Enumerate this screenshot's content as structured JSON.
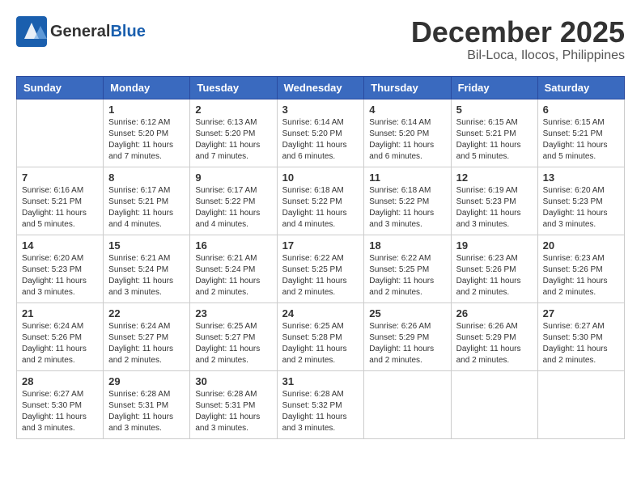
{
  "header": {
    "logo_general": "General",
    "logo_blue": "Blue",
    "month": "December 2025",
    "location": "Bil-Loca, Ilocos, Philippines"
  },
  "days_of_week": [
    "Sunday",
    "Monday",
    "Tuesday",
    "Wednesday",
    "Thursday",
    "Friday",
    "Saturday"
  ],
  "weeks": [
    [
      {
        "day": "",
        "info": ""
      },
      {
        "day": "1",
        "info": "Sunrise: 6:12 AM\nSunset: 5:20 PM\nDaylight: 11 hours\nand 7 minutes."
      },
      {
        "day": "2",
        "info": "Sunrise: 6:13 AM\nSunset: 5:20 PM\nDaylight: 11 hours\nand 7 minutes."
      },
      {
        "day": "3",
        "info": "Sunrise: 6:14 AM\nSunset: 5:20 PM\nDaylight: 11 hours\nand 6 minutes."
      },
      {
        "day": "4",
        "info": "Sunrise: 6:14 AM\nSunset: 5:20 PM\nDaylight: 11 hours\nand 6 minutes."
      },
      {
        "day": "5",
        "info": "Sunrise: 6:15 AM\nSunset: 5:21 PM\nDaylight: 11 hours\nand 5 minutes."
      },
      {
        "day": "6",
        "info": "Sunrise: 6:15 AM\nSunset: 5:21 PM\nDaylight: 11 hours\nand 5 minutes."
      }
    ],
    [
      {
        "day": "7",
        "info": "Sunrise: 6:16 AM\nSunset: 5:21 PM\nDaylight: 11 hours\nand 5 minutes."
      },
      {
        "day": "8",
        "info": "Sunrise: 6:17 AM\nSunset: 5:21 PM\nDaylight: 11 hours\nand 4 minutes."
      },
      {
        "day": "9",
        "info": "Sunrise: 6:17 AM\nSunset: 5:22 PM\nDaylight: 11 hours\nand 4 minutes."
      },
      {
        "day": "10",
        "info": "Sunrise: 6:18 AM\nSunset: 5:22 PM\nDaylight: 11 hours\nand 4 minutes."
      },
      {
        "day": "11",
        "info": "Sunrise: 6:18 AM\nSunset: 5:22 PM\nDaylight: 11 hours\nand 3 minutes."
      },
      {
        "day": "12",
        "info": "Sunrise: 6:19 AM\nSunset: 5:23 PM\nDaylight: 11 hours\nand 3 minutes."
      },
      {
        "day": "13",
        "info": "Sunrise: 6:20 AM\nSunset: 5:23 PM\nDaylight: 11 hours\nand 3 minutes."
      }
    ],
    [
      {
        "day": "14",
        "info": "Sunrise: 6:20 AM\nSunset: 5:23 PM\nDaylight: 11 hours\nand 3 minutes."
      },
      {
        "day": "15",
        "info": "Sunrise: 6:21 AM\nSunset: 5:24 PM\nDaylight: 11 hours\nand 3 minutes."
      },
      {
        "day": "16",
        "info": "Sunrise: 6:21 AM\nSunset: 5:24 PM\nDaylight: 11 hours\nand 2 minutes."
      },
      {
        "day": "17",
        "info": "Sunrise: 6:22 AM\nSunset: 5:25 PM\nDaylight: 11 hours\nand 2 minutes."
      },
      {
        "day": "18",
        "info": "Sunrise: 6:22 AM\nSunset: 5:25 PM\nDaylight: 11 hours\nand 2 minutes."
      },
      {
        "day": "19",
        "info": "Sunrise: 6:23 AM\nSunset: 5:26 PM\nDaylight: 11 hours\nand 2 minutes."
      },
      {
        "day": "20",
        "info": "Sunrise: 6:23 AM\nSunset: 5:26 PM\nDaylight: 11 hours\nand 2 minutes."
      }
    ],
    [
      {
        "day": "21",
        "info": "Sunrise: 6:24 AM\nSunset: 5:26 PM\nDaylight: 11 hours\nand 2 minutes."
      },
      {
        "day": "22",
        "info": "Sunrise: 6:24 AM\nSunset: 5:27 PM\nDaylight: 11 hours\nand 2 minutes."
      },
      {
        "day": "23",
        "info": "Sunrise: 6:25 AM\nSunset: 5:27 PM\nDaylight: 11 hours\nand 2 minutes."
      },
      {
        "day": "24",
        "info": "Sunrise: 6:25 AM\nSunset: 5:28 PM\nDaylight: 11 hours\nand 2 minutes."
      },
      {
        "day": "25",
        "info": "Sunrise: 6:26 AM\nSunset: 5:29 PM\nDaylight: 11 hours\nand 2 minutes."
      },
      {
        "day": "26",
        "info": "Sunrise: 6:26 AM\nSunset: 5:29 PM\nDaylight: 11 hours\nand 2 minutes."
      },
      {
        "day": "27",
        "info": "Sunrise: 6:27 AM\nSunset: 5:30 PM\nDaylight: 11 hours\nand 2 minutes."
      }
    ],
    [
      {
        "day": "28",
        "info": "Sunrise: 6:27 AM\nSunset: 5:30 PM\nDaylight: 11 hours\nand 3 minutes."
      },
      {
        "day": "29",
        "info": "Sunrise: 6:28 AM\nSunset: 5:31 PM\nDaylight: 11 hours\nand 3 minutes."
      },
      {
        "day": "30",
        "info": "Sunrise: 6:28 AM\nSunset: 5:31 PM\nDaylight: 11 hours\nand 3 minutes."
      },
      {
        "day": "31",
        "info": "Sunrise: 6:28 AM\nSunset: 5:32 PM\nDaylight: 11 hours\nand 3 minutes."
      },
      {
        "day": "",
        "info": ""
      },
      {
        "day": "",
        "info": ""
      },
      {
        "day": "",
        "info": ""
      }
    ]
  ]
}
